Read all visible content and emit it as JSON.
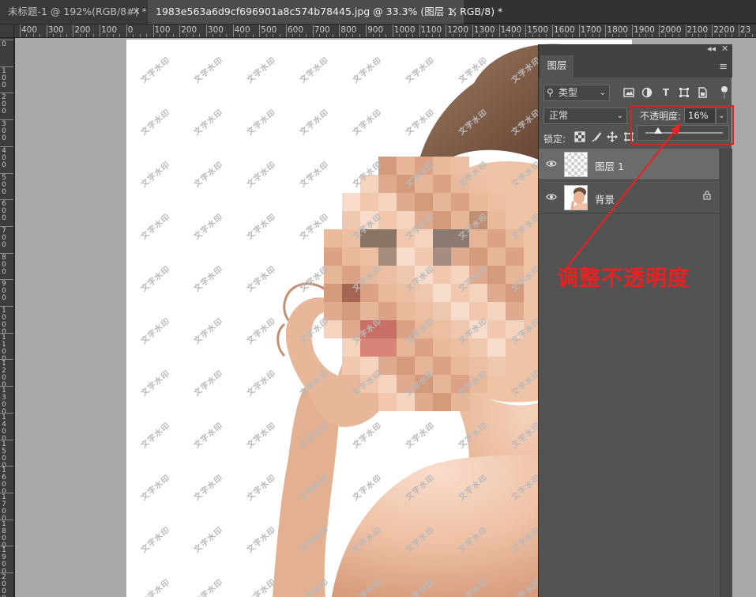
{
  "tabs": [
    {
      "label": "未标题-1 @ 192%(RGB/8#) *",
      "close": "×",
      "active": false
    },
    {
      "label": "1983e563a6d9cf696901a8c574b78445.jpg @ 33.3% (图层 1, RGB/8) *",
      "close": "×",
      "active": true
    }
  ],
  "ruler": {
    "h_labels": [
      "400",
      "300",
      "200",
      "100",
      "0",
      "100",
      "200",
      "300",
      "400",
      "500",
      "600",
      "700",
      "800",
      "900",
      "1000",
      "1100",
      "1200",
      "1300",
      "1400",
      "1500",
      "1600",
      "1700",
      "1800",
      "1900",
      "2000",
      "2100",
      "2200",
      "23"
    ],
    "v_labels": [
      "0",
      "100",
      "200",
      "300",
      "400",
      "500",
      "600",
      "700",
      "800",
      "900",
      "1000",
      "1100",
      "1200",
      "1300",
      "1400",
      "1500",
      "1600",
      "1700",
      "1800",
      "1900",
      "2000"
    ]
  },
  "canvas": {
    "watermark_text": "文字水印"
  },
  "layers_panel": {
    "title": "图层",
    "collapse_glyph": "◂◂",
    "close_glyph": "✕",
    "menu_glyph": "≡",
    "filter_label": "类型",
    "filter_icons": [
      "image-filter-icon",
      "adjustment-filter-icon",
      "type-filter-icon",
      "shape-filter-icon",
      "smart-object-filter-icon"
    ],
    "blend_mode": "正常",
    "opacity_label": "不透明度:",
    "opacity_value": "16%",
    "opacity_fraction": 0.16,
    "lock_label": "锁定:",
    "layers": [
      {
        "name": "图层 1",
        "visible": true,
        "selected": true,
        "locked": false
      },
      {
        "name": "背景",
        "visible": true,
        "selected": false,
        "locked": true
      }
    ]
  },
  "annotation": {
    "text": "调整不透明度",
    "color": "#e82222"
  },
  "colors": {
    "highlight": "#e41e1e",
    "panel_bg": "#535353",
    "selected_layer": "#6b6b6b"
  }
}
